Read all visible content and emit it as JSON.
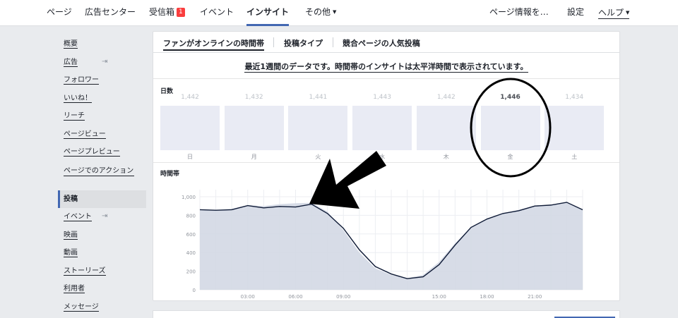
{
  "nav": {
    "items": [
      {
        "key": "page",
        "label": "ページ"
      },
      {
        "key": "ad_center",
        "label": "広告センター"
      },
      {
        "key": "inbox",
        "label": "受信箱",
        "badge": "1"
      },
      {
        "key": "events",
        "label": "イベント"
      },
      {
        "key": "insights",
        "label": "インサイト"
      },
      {
        "key": "more",
        "label": "その他"
      }
    ],
    "page_info": "ページ情報を…",
    "settings": "設定",
    "help": "ヘルプ"
  },
  "sidebar": {
    "items": [
      {
        "label": "概要"
      },
      {
        "label": "広告"
      },
      {
        "label": "フォロワー"
      },
      {
        "label": "いいね！"
      },
      {
        "label": "リーチ"
      },
      {
        "label": "ページビュー"
      },
      {
        "label": "ページプレビュー"
      },
      {
        "label": "ページでのアクション"
      },
      {
        "label": "投稿"
      },
      {
        "label": "イベント"
      },
      {
        "label": "映画"
      },
      {
        "label": "動画"
      },
      {
        "label": "ストーリーズ"
      },
      {
        "label": "利用者"
      },
      {
        "label": "メッセージ"
      }
    ]
  },
  "tabs": [
    {
      "label": "ファンがオンラインの時間帯"
    },
    {
      "label": "投稿タイプ"
    },
    {
      "label": "競合ページの人気投稿"
    }
  ],
  "notice": "最近1週間のデータです。時間帯のインサイトは太平洋時間で表示されています。",
  "days_section": {
    "label": "日数",
    "days": [
      {
        "name": "日",
        "value": "1,442"
      },
      {
        "name": "月",
        "value": "1,432"
      },
      {
        "name": "火",
        "value": "1,441"
      },
      {
        "name": "水",
        "value": "1,443"
      },
      {
        "name": "木",
        "value": "1,442"
      },
      {
        "name": "金",
        "value": "1,446"
      },
      {
        "name": "土",
        "value": "1,434"
      }
    ]
  },
  "hours_section": {
    "label": "時間帯"
  },
  "colors": {
    "accent": "#4267b2",
    "badge": "#fa3e3e",
    "area_fill": "#d3d8e4",
    "line": "#0e1a36",
    "day_box": "#e9ebf4"
  },
  "chart_data": {
    "type": "area",
    "x": [
      "00:00",
      "01:00",
      "02:00",
      "03:00",
      "04:00",
      "05:00",
      "06:00",
      "07:00",
      "08:00",
      "09:00",
      "10:00",
      "11:00",
      "12:00",
      "13:00",
      "14:00",
      "15:00",
      "16:00",
      "17:00",
      "18:00",
      "19:00",
      "20:00",
      "21:00",
      "22:00",
      "23:00",
      "24:00"
    ],
    "series": [
      {
        "values": [
          860,
          855,
          860,
          905,
          880,
          895,
          890,
          920,
          820,
          660,
          430,
          250,
          170,
          120,
          140,
          270,
          480,
          670,
          760,
          820,
          850,
          900,
          910,
          940,
          860
        ]
      },
      {
        "values": [
          860,
          855,
          870,
          910,
          900,
          920,
          930,
          935,
          840,
          640,
          400,
          230,
          160,
          125,
          160,
          300,
          500,
          670,
          760,
          820,
          860,
          905,
          910,
          940,
          860
        ]
      }
    ],
    "xticks": [
      "03:00",
      "06:00",
      "09:00",
      "15:00",
      "18:00",
      "21:00"
    ],
    "yticks": [
      "0",
      "200",
      "400",
      "600",
      "800",
      "1,000"
    ],
    "ylim": [
      0,
      1000
    ],
    "grid": true
  }
}
